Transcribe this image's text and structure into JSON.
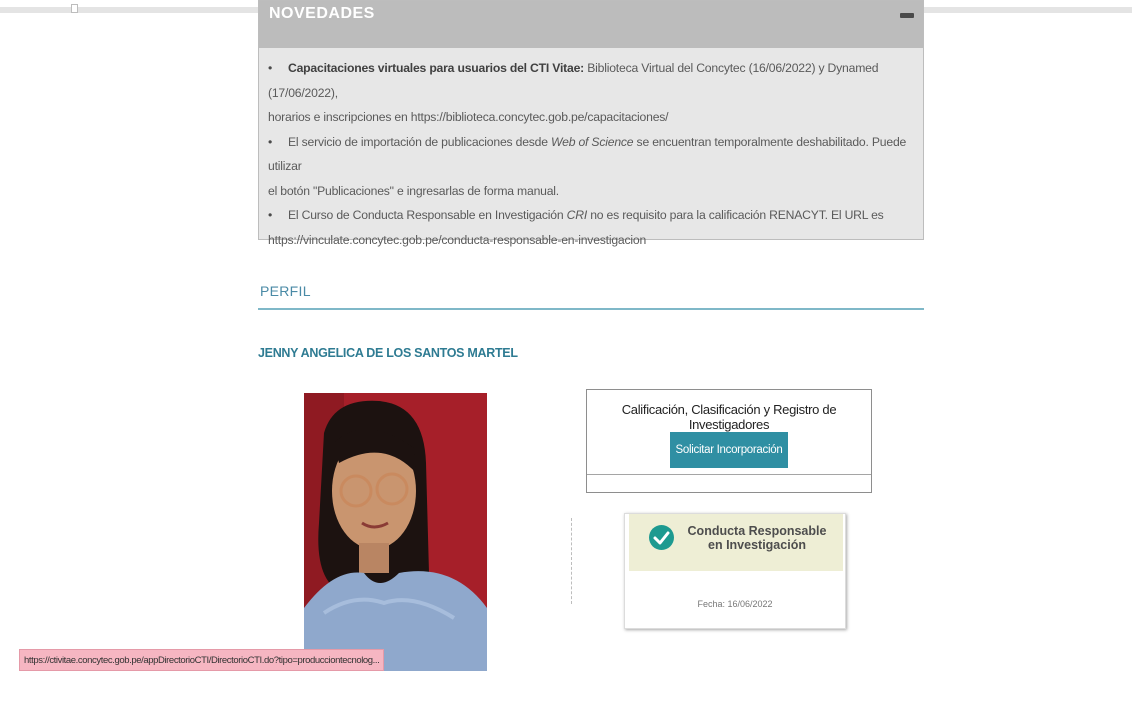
{
  "news": {
    "title": "NOVEDADES",
    "items": [
      {
        "bold": "Capacitaciones virtuales para usuarios del CTI Vitae:",
        "line1": " Biblioteca Virtual del Concytec (16/06/2022) y Dynamed (17/06/2022),",
        "line2": "horarios e inscripciones en https://biblioteca.concytec.gob.pe/capacitaciones/"
      },
      {
        "pre": "El servicio de importación de publicaciones desde ",
        "italic": "Web of Science",
        "post": " se encuentran temporalmente deshabilitado. Puede utilizar",
        "line2": "el botón \"Publicaciones\" e ingresarlas de forma manual."
      },
      {
        "pre": "El Curso de Conducta Responsable en Investigación ",
        "italic": "CRI",
        "post": " no es requisito para la calificación RENACYT. El URL es",
        "line2": "https://vinculate.concytec.gob.pe/conducta-responsable-en-investigacion"
      }
    ]
  },
  "profile": {
    "section_title": "PERFIL",
    "name": "JENNY ANGELICA DE LOS SANTOS MARTEL"
  },
  "calificacion": {
    "title": "Calificación, Clasificación y Registro de Investigadores",
    "button_label": "Solicitar Incorporación"
  },
  "cri_badge": {
    "line1": "Conducta Responsable",
    "line2": "en Investigación",
    "date": "Fecha: 16/06/2022"
  },
  "status_bar": {
    "url": "https://ctivitae.concytec.gob.pe/appDirectorioCTI/DirectorioCTI.do?tipo=producciontecnolog..."
  },
  "colors": {
    "accent": "#2f8fa3",
    "name_color": "#2e7b92",
    "photo_bg": "#a61f29",
    "badge_check": "#1d9a90"
  }
}
